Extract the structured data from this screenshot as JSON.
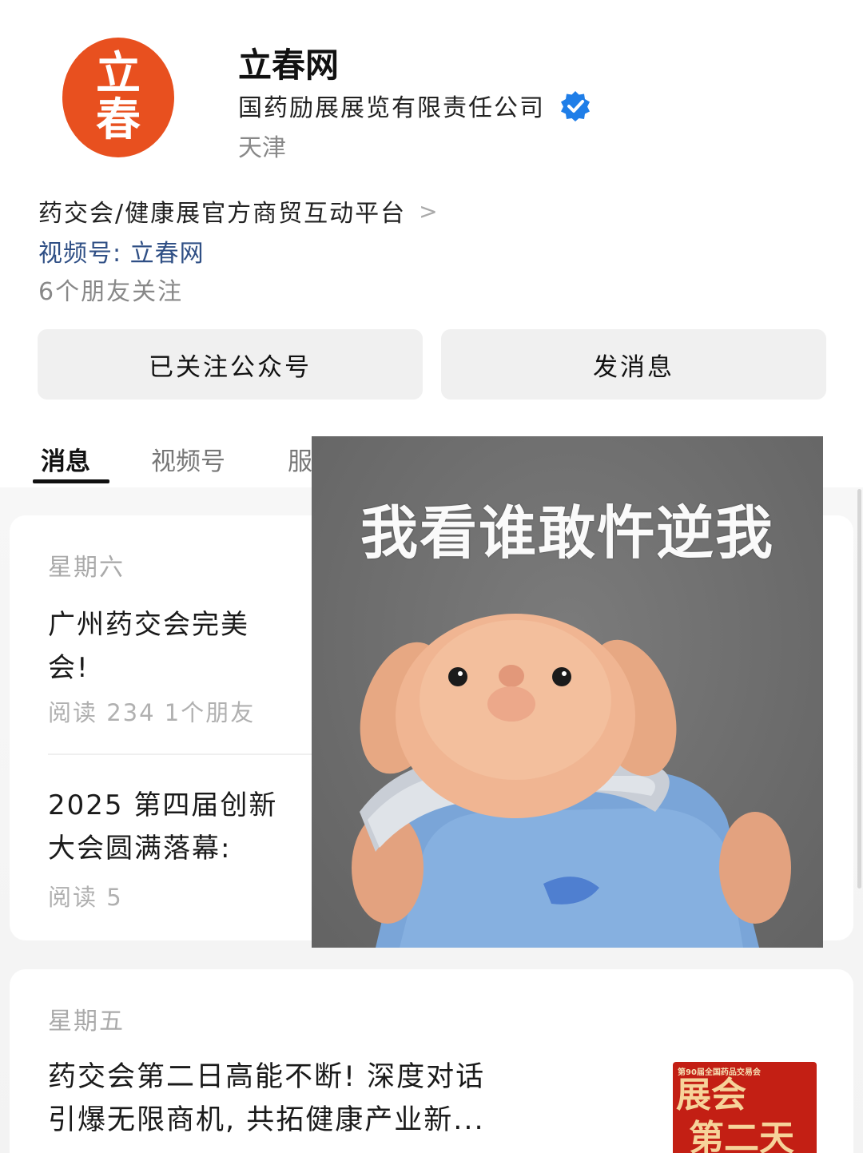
{
  "profile": {
    "logo_chars": [
      "立",
      "春"
    ],
    "name": "立春网",
    "company": "国药励展展览有限责任公司",
    "location": "天津",
    "intro": "药交会/健康展官方商贸互动平台",
    "channel": "视频号: 立春网",
    "friends": "6个朋友关注",
    "verify_color": "#1f7ee8",
    "logo_color": "#e8501f"
  },
  "buttons": {
    "follow": "已关注公众号",
    "message": "发消息"
  },
  "tabs": [
    "消息",
    "视频号",
    "服"
  ],
  "feed": {
    "groups": [
      {
        "day": "星期六",
        "articles": [
          {
            "title_lines": [
              "广州药交会完美",
              "会!"
            ],
            "meta": "阅读 234   1个朋友"
          },
          {
            "title_lines": [
              "2025 第四届创新",
              "大会圆满落幕:"
            ],
            "meta": "阅读 5"
          }
        ]
      },
      {
        "day": "星期五",
        "articles": [
          {
            "title_lines": [
              "药交会第二日高能不断! 深度对话",
              "引爆无限商机, 共拓健康产业新..."
            ],
            "thumb_top": "第90届全国药品交易会",
            "thumb_big": "展会",
            "thumb_big2": "第二天"
          }
        ]
      }
    ]
  },
  "meme": {
    "caption": "我看谁敢忤逆我"
  }
}
